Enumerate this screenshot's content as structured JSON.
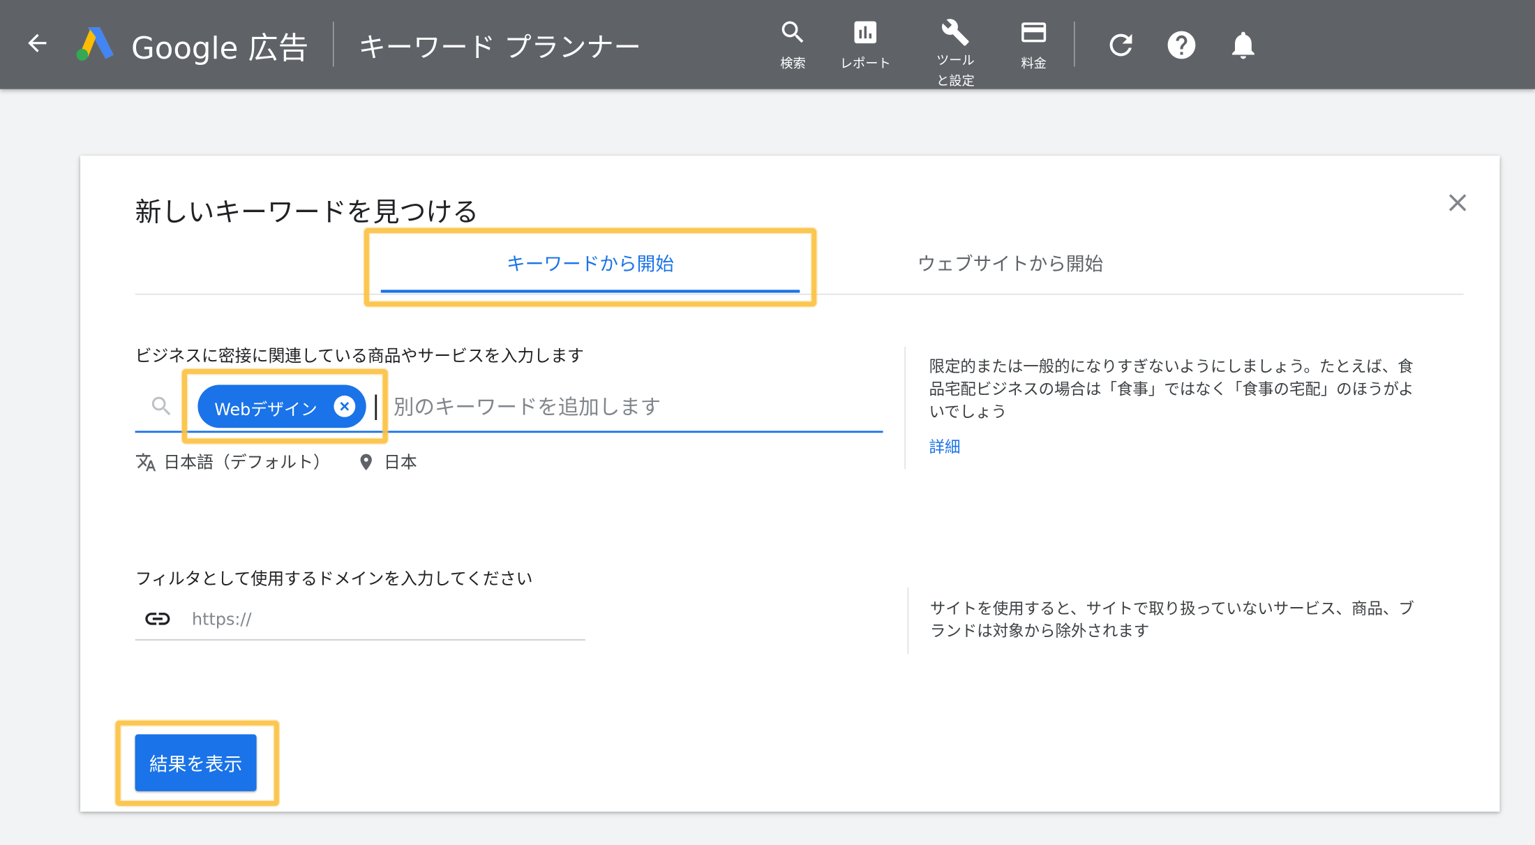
{
  "topbar": {
    "brand": "Google 広告",
    "tool_title": "キーワード プランナー",
    "items": [
      {
        "label": "検索",
        "icon": "search-icon"
      },
      {
        "label": "レポート",
        "icon": "reports-icon"
      },
      {
        "label": "ツールと設定",
        "icon": "wrench-icon"
      },
      {
        "label": "料金",
        "icon": "credit-card-icon"
      }
    ],
    "actions": [
      "refresh-icon",
      "help-icon",
      "notifications-icon"
    ]
  },
  "dialog": {
    "title": "新しいキーワードを見つける",
    "tabs": [
      {
        "label": "キーワードから開始",
        "selected": true
      },
      {
        "label": "ウェブサイトから開始",
        "selected": false
      }
    ],
    "keywords": {
      "label": "ビジネスに密接に関連している商品やサービスを入力します",
      "chips": [
        {
          "text": "Webデザイン"
        }
      ],
      "placeholder": "別のキーワードを追加します",
      "language": "日本語（デフォルト）",
      "location": "日本",
      "help_text": "限定的または一般的になりすぎないようにしましょう。たとえば、食品宅配ビジネスの場合は「食事」ではなく「食事の宅配」のほうがよいでしょう",
      "help_link": "詳細"
    },
    "domain": {
      "label": "フィルタとして使用するドメインを入力してください",
      "placeholder": "https://",
      "help_text": "サイトを使用すると、サイトで取り扱っていないサービス、商品、ブランドは対象から除外されます"
    },
    "submit_label": "結果を表示"
  },
  "colors": {
    "topbar": "#5f6368",
    "accent": "#1a73e8",
    "highlight": "#fbc243",
    "background": "#f1f3f4"
  }
}
